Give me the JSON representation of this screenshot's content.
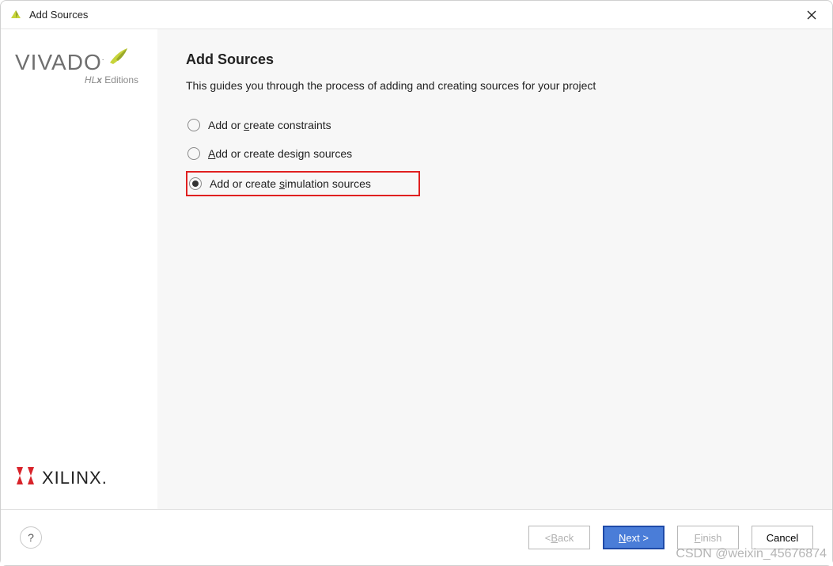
{
  "window": {
    "title": "Add Sources"
  },
  "sidebar": {
    "vivado_word": "VIVADO",
    "vivado_sub": "HLx Editions",
    "xilinx_word": "XILINX."
  },
  "main": {
    "heading": "Add Sources",
    "description": "This guides you through the process of adding and creating sources for your project",
    "options": [
      {
        "pre": "Add or ",
        "key": "c",
        "post": "reate constraints",
        "selected": false
      },
      {
        "pre": "",
        "key": "A",
        "post": "dd or create design sources",
        "selected": false
      },
      {
        "pre": "Add or create ",
        "key": "s",
        "post": "imulation sources",
        "selected": true
      }
    ]
  },
  "footer": {
    "help": "?",
    "back_pre": "< ",
    "back_key": "B",
    "back_post": "ack",
    "next_key": "N",
    "next_post": "ext >",
    "finish_key": "F",
    "finish_post": "inish",
    "cancel": "Cancel"
  },
  "watermark": "CSDN @weixin_45676874"
}
